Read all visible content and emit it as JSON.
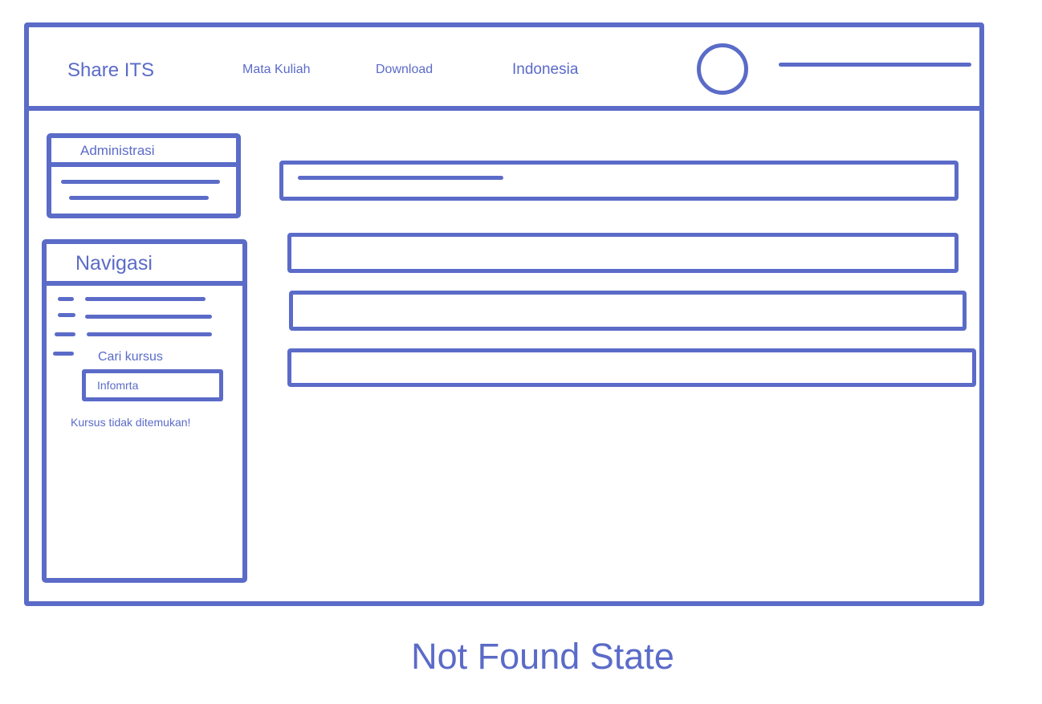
{
  "header": {
    "brand": "Share ITS",
    "nav_links": [
      "Mata Kuliah",
      "Download"
    ],
    "language": "Indonesia"
  },
  "sidebar": {
    "administration": {
      "title": "Administrasi"
    },
    "navigation": {
      "title": "Navigasi",
      "search_label": "Cari kursus",
      "search_value": "Infomrta",
      "not_found_message": "Kursus tidak ditemukan!"
    }
  },
  "caption": "Not Found State",
  "colors": {
    "accent": "#5b6bc8",
    "background": "#ffffff"
  }
}
